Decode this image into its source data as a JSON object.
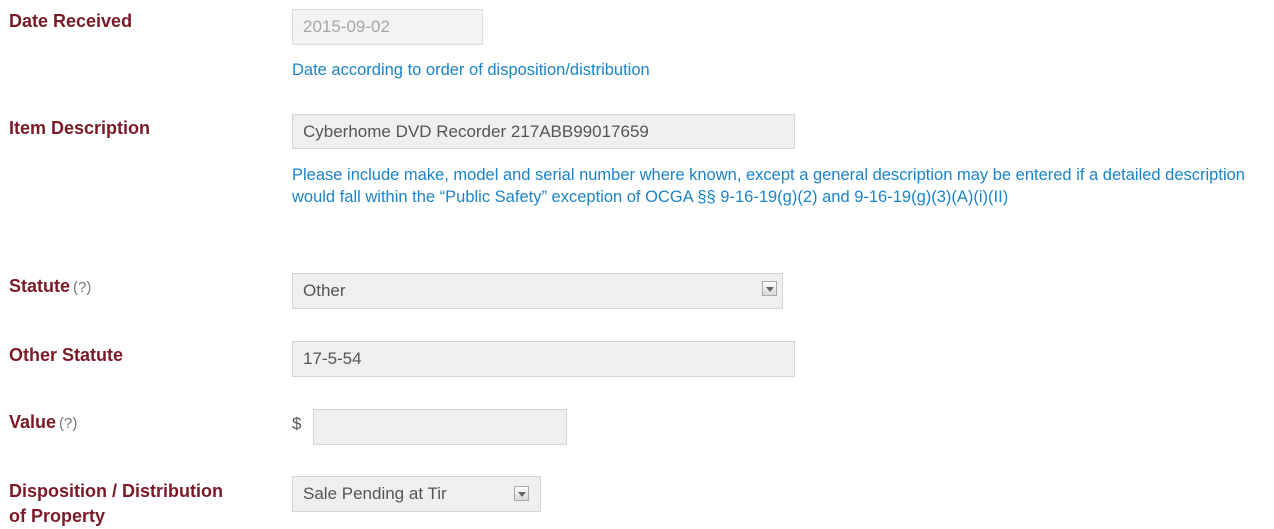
{
  "fields": {
    "date_received": {
      "label": "Date Received",
      "value": "2015-09-02",
      "hint": "Date according to order of disposition/distribution"
    },
    "item_description": {
      "label": "Item Description",
      "value": "Cyberhome  DVD Recorder 217ABB99017659",
      "hint": "Please include make, model and serial number where known, except a general description may be entered if a detailed description would fall within the “Public Safety” exception of OCGA §§ 9-16-19(g)(2) and 9-16-19(g)(3)(A)(i)(II)"
    },
    "statute": {
      "label": "Statute",
      "help": "(?)",
      "value": "Other"
    },
    "other_statute": {
      "label": "Other Statute",
      "value": "17-5-54"
    },
    "value": {
      "label": "Value",
      "help": "(?)",
      "currency": "$",
      "value": ""
    },
    "disposition": {
      "label_line1": "Disposition / Distribution",
      "label_line2": "of Property",
      "value": "Sale Pending at Tir"
    }
  },
  "icons": {
    "dropdown": "chevron-down-icon"
  }
}
